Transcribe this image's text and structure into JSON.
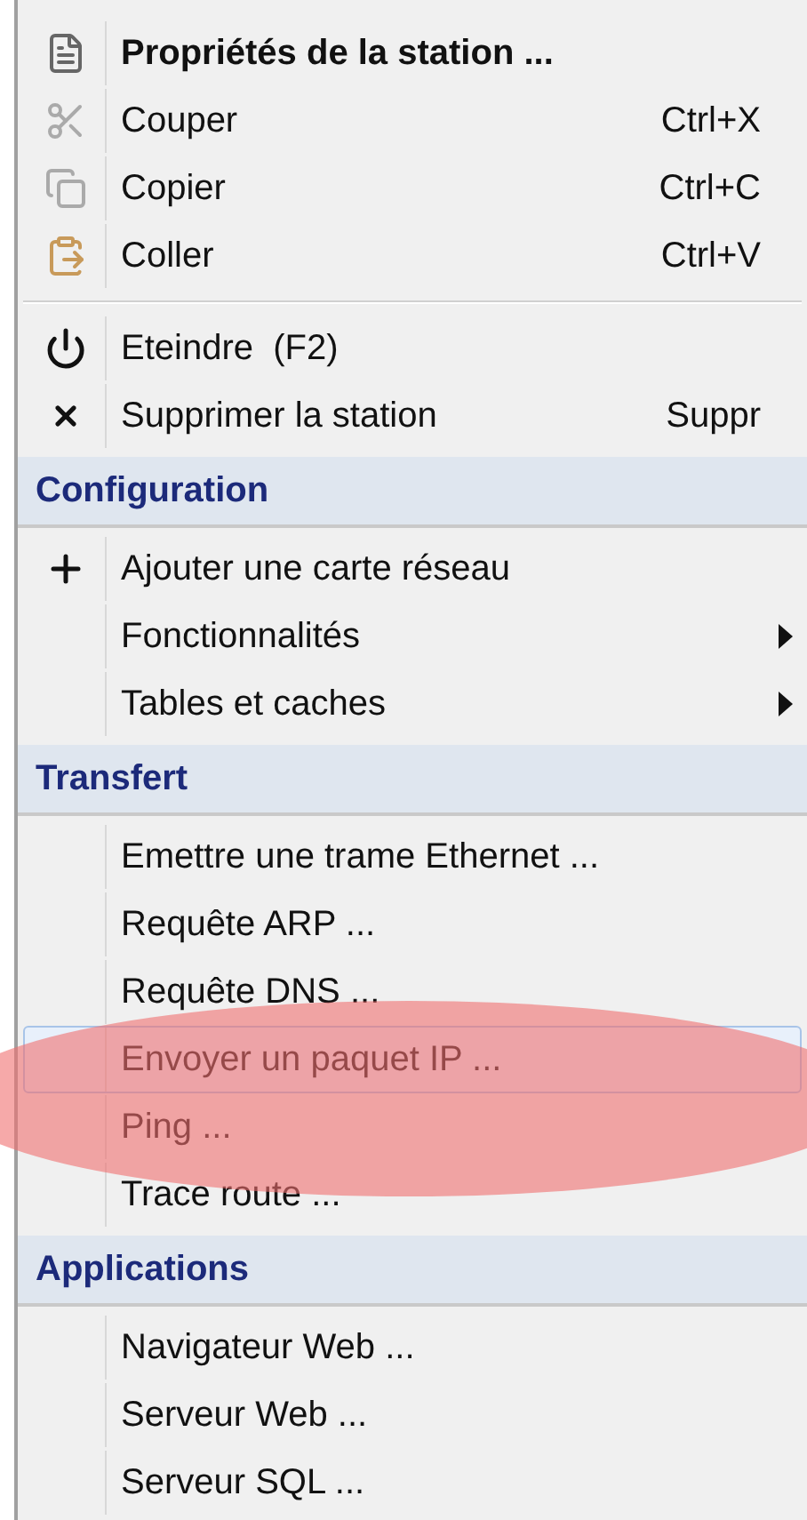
{
  "groups": [
    {
      "items": [
        {
          "label": "Propriétés de la station ...",
          "default": true,
          "selected": false,
          "submenu": false
        },
        {
          "label": "Couper",
          "shortcut": "Ctrl+X",
          "default": false,
          "selected": false,
          "submenu": false
        },
        {
          "label": "Copier",
          "shortcut": "Ctrl+C",
          "default": false,
          "selected": false,
          "submenu": false
        },
        {
          "label": "Coller",
          "shortcut": "Ctrl+V",
          "default": false,
          "selected": false,
          "submenu": false
        }
      ]
    },
    {
      "items": [
        {
          "label": "Eteindre  (F2)",
          "default": false,
          "selected": false,
          "submenu": false
        },
        {
          "label": "Supprimer la station",
          "shortcut": "Suppr",
          "default": false,
          "selected": false,
          "submenu": false
        }
      ]
    },
    {
      "header": "Configuration",
      "items": [
        {
          "label": "Ajouter une carte réseau",
          "default": false,
          "selected": false,
          "submenu": false
        },
        {
          "label": "Fonctionnalités",
          "default": false,
          "selected": false,
          "submenu": true
        },
        {
          "label": "Tables et caches",
          "default": false,
          "selected": false,
          "submenu": true
        }
      ]
    },
    {
      "header": "Transfert",
      "items": [
        {
          "label": "Emettre une trame Ethernet ...",
          "default": false,
          "selected": false,
          "submenu": false
        },
        {
          "label": "Requête ARP ...",
          "default": false,
          "selected": false,
          "submenu": false
        },
        {
          "label": "Requête DNS ...",
          "default": false,
          "selected": false,
          "submenu": false
        },
        {
          "label": "Envoyer un paquet IP ...",
          "default": false,
          "selected": true,
          "submenu": false
        },
        {
          "label": "Ping ...",
          "default": false,
          "selected": false,
          "submenu": false
        },
        {
          "label": "Trace route ...",
          "default": false,
          "selected": false,
          "submenu": false
        }
      ]
    },
    {
      "header": "Applications",
      "items": [
        {
          "label": "Navigateur Web ...",
          "default": false,
          "selected": false,
          "submenu": false
        },
        {
          "label": "Serveur Web ...",
          "default": false,
          "selected": false,
          "submenu": false
        },
        {
          "label": "Serveur SQL ...",
          "default": false,
          "selected": false,
          "submenu": false
        }
      ]
    }
  ],
  "annotation": {
    "kind": "ellipse"
  }
}
